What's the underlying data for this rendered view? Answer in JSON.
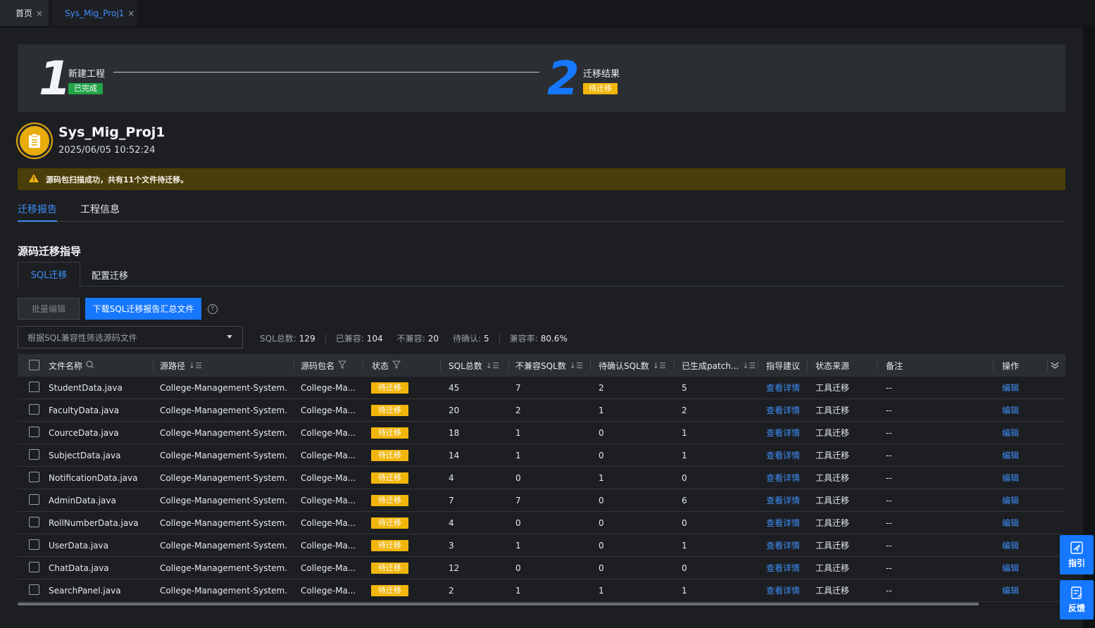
{
  "tabs": [
    {
      "label": "首页",
      "close": "×"
    },
    {
      "label": "Sys_Mig_Proj1",
      "close": "×"
    }
  ],
  "steps": [
    {
      "num": "1",
      "title": "新建工程",
      "status": "已完成"
    },
    {
      "num": "2",
      "title": "迁移结果",
      "status": "待迁移"
    }
  ],
  "project": {
    "name": "Sys_Mig_Proj1",
    "time": "2025/06/05 10:52:24"
  },
  "alert": "源码包扫描成功，共有11个文件待迁移。",
  "main_tabs": [
    "迁移报告",
    "工程信息"
  ],
  "section_title": "源码迁移指导",
  "sub_tabs": [
    "SQL迁移",
    "配置迁移"
  ],
  "toolbar": {
    "batch_edit": "批量编辑",
    "download": "下载SQL迁移报告汇总文件",
    "help": "?"
  },
  "filter": {
    "placeholder": "根据SQL兼容性筛选源码文件"
  },
  "stats": {
    "sql_total_label": "SQL总数:",
    "sql_total": "129",
    "compatible_label": "已兼容:",
    "compatible": "104",
    "incompatible_label": "不兼容:",
    "incompatible": "20",
    "pending_label": "待确认:",
    "pending": "5",
    "rate_label": "兼容率:",
    "rate": "80.6%"
  },
  "table": {
    "headers": [
      "文件名称",
      "源路径",
      "源码包名",
      "状态",
      "SQL总数",
      "不兼容SQL数",
      "待确认SQL数",
      "已生成patch...",
      "指导建议",
      "状态来源",
      "备注",
      "操作"
    ],
    "rows": [
      {
        "file": "StudentData.java",
        "path": "College-Management-System...",
        "pkg": "College-Ma...",
        "status": "待迁移",
        "sql": "45",
        "incomp": "7",
        "pend": "2",
        "patch": "5",
        "guide": "查看详情",
        "source": "工具迁移",
        "note": "--",
        "op": "编辑"
      },
      {
        "file": "FacultyData.java",
        "path": "College-Management-System...",
        "pkg": "College-Ma...",
        "status": "待迁移",
        "sql": "20",
        "incomp": "2",
        "pend": "1",
        "patch": "2",
        "guide": "查看详情",
        "source": "工具迁移",
        "note": "--",
        "op": "编辑"
      },
      {
        "file": "CourceData.java",
        "path": "College-Management-System...",
        "pkg": "College-Ma...",
        "status": "待迁移",
        "sql": "18",
        "incomp": "1",
        "pend": "0",
        "patch": "1",
        "guide": "查看详情",
        "source": "工具迁移",
        "note": "--",
        "op": "编辑"
      },
      {
        "file": "SubjectData.java",
        "path": "College-Management-System...",
        "pkg": "College-Ma...",
        "status": "待迁移",
        "sql": "14",
        "incomp": "1",
        "pend": "0",
        "patch": "1",
        "guide": "查看详情",
        "source": "工具迁移",
        "note": "--",
        "op": "编辑"
      },
      {
        "file": "NotificationData.java",
        "path": "College-Management-System...",
        "pkg": "College-Ma...",
        "status": "待迁移",
        "sql": "4",
        "incomp": "0",
        "pend": "1",
        "patch": "0",
        "guide": "查看详情",
        "source": "工具迁移",
        "note": "--",
        "op": "编辑"
      },
      {
        "file": "AdminData.java",
        "path": "College-Management-System...",
        "pkg": "College-Ma...",
        "status": "待迁移",
        "sql": "7",
        "incomp": "7",
        "pend": "0",
        "patch": "6",
        "guide": "查看详情",
        "source": "工具迁移",
        "note": "--",
        "op": "编辑"
      },
      {
        "file": "RollNumberData.java",
        "path": "College-Management-System...",
        "pkg": "College-Ma...",
        "status": "待迁移",
        "sql": "4",
        "incomp": "0",
        "pend": "0",
        "patch": "0",
        "guide": "查看详情",
        "source": "工具迁移",
        "note": "--",
        "op": "编辑"
      },
      {
        "file": "UserData.java",
        "path": "College-Management-System...",
        "pkg": "College-Ma...",
        "status": "待迁移",
        "sql": "3",
        "incomp": "1",
        "pend": "0",
        "patch": "1",
        "guide": "查看详情",
        "source": "工具迁移",
        "note": "--",
        "op": "编辑"
      },
      {
        "file": "ChatData.java",
        "path": "College-Management-System...",
        "pkg": "College-Ma...",
        "status": "待迁移",
        "sql": "12",
        "incomp": "0",
        "pend": "0",
        "patch": "0",
        "guide": "查看详情",
        "source": "工具迁移",
        "note": "--",
        "op": "编辑"
      },
      {
        "file": "SearchPanel.java",
        "path": "College-Management-System...",
        "pkg": "College-Ma...",
        "status": "待迁移",
        "sql": "2",
        "incomp": "1",
        "pend": "1",
        "patch": "1",
        "guide": "查看详情",
        "source": "工具迁移",
        "note": "--",
        "op": "编辑"
      }
    ]
  },
  "float_buttons": [
    "指引",
    "反馈"
  ],
  "colors": {
    "accent": "#1677ff",
    "success": "#22a447",
    "warning": "#f1b50b",
    "alert_bg": "#4b3e0a"
  }
}
